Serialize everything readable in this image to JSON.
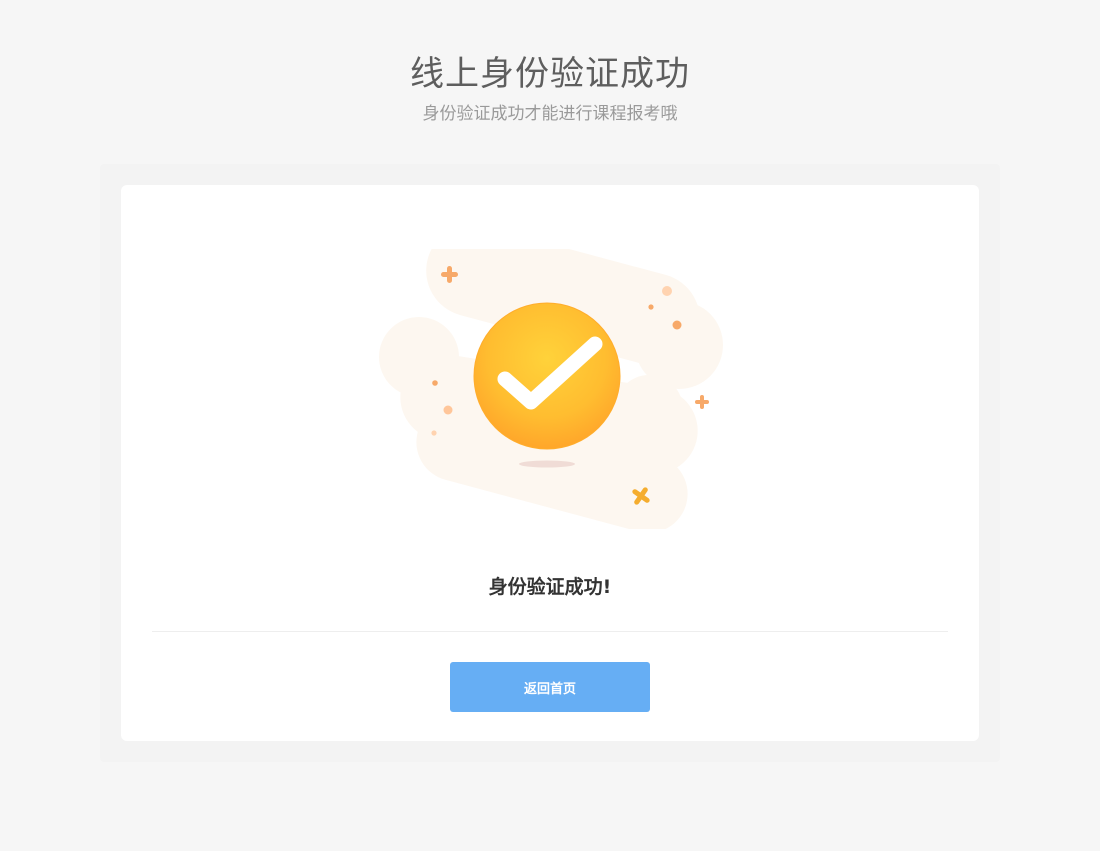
{
  "header": {
    "title": "线上身份验证成功",
    "subtitle": "身份验证成功才能进行课程报考哦"
  },
  "card": {
    "illustration_icon": "check-circle-icon",
    "message": "身份验证成功!",
    "home_button_label": "返回首页"
  },
  "colors": {
    "page_background": "#f6f6f6",
    "card_background": "#ffffff",
    "accent_orange": "#ffb02e",
    "button_blue": "#66aef4"
  }
}
